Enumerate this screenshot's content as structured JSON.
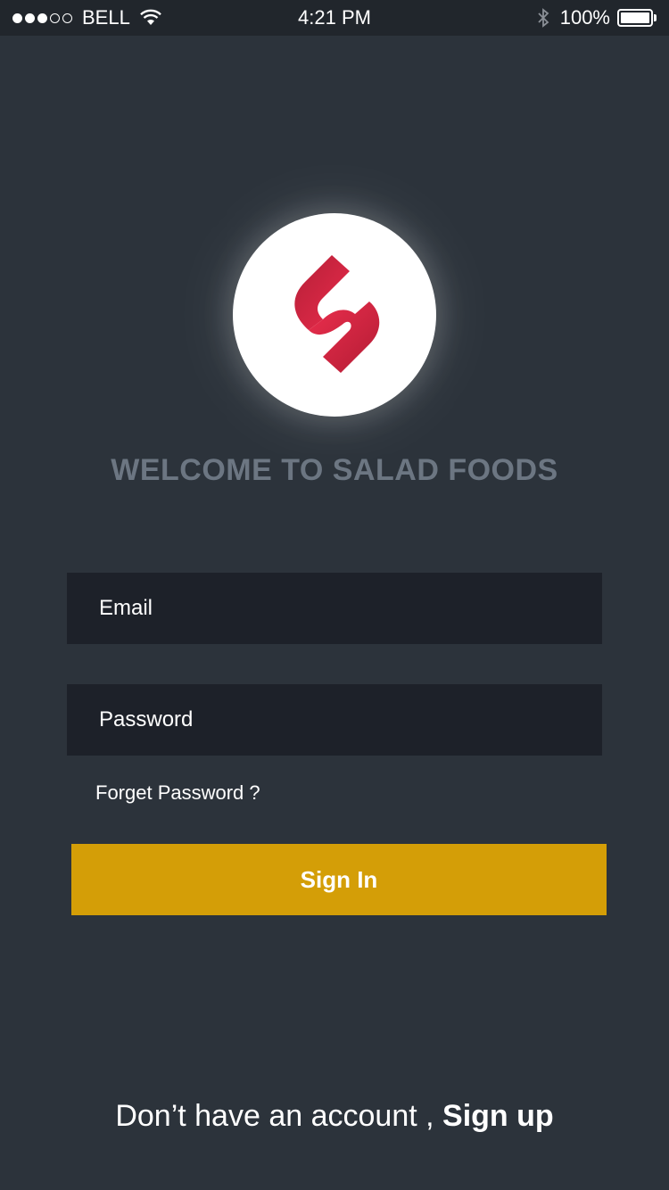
{
  "status_bar": {
    "carrier": "BELL",
    "time": "4:21 PM",
    "battery": "100%"
  },
  "welcome": {
    "title": "WELCOME TO SALAD FOODS"
  },
  "form": {
    "email_placeholder": "Email",
    "password_placeholder": "Password",
    "forgot_label": "Forget Password ?",
    "signin_label": "Sign In"
  },
  "footer": {
    "prompt": "Don’t have an account ,",
    "signup_label": "Sign up"
  },
  "colors": {
    "background": "#2c333b",
    "field": "#1d2129",
    "accent": "#d49e07",
    "muted_text": "#6c7682",
    "logo_red": "#e0284a"
  }
}
